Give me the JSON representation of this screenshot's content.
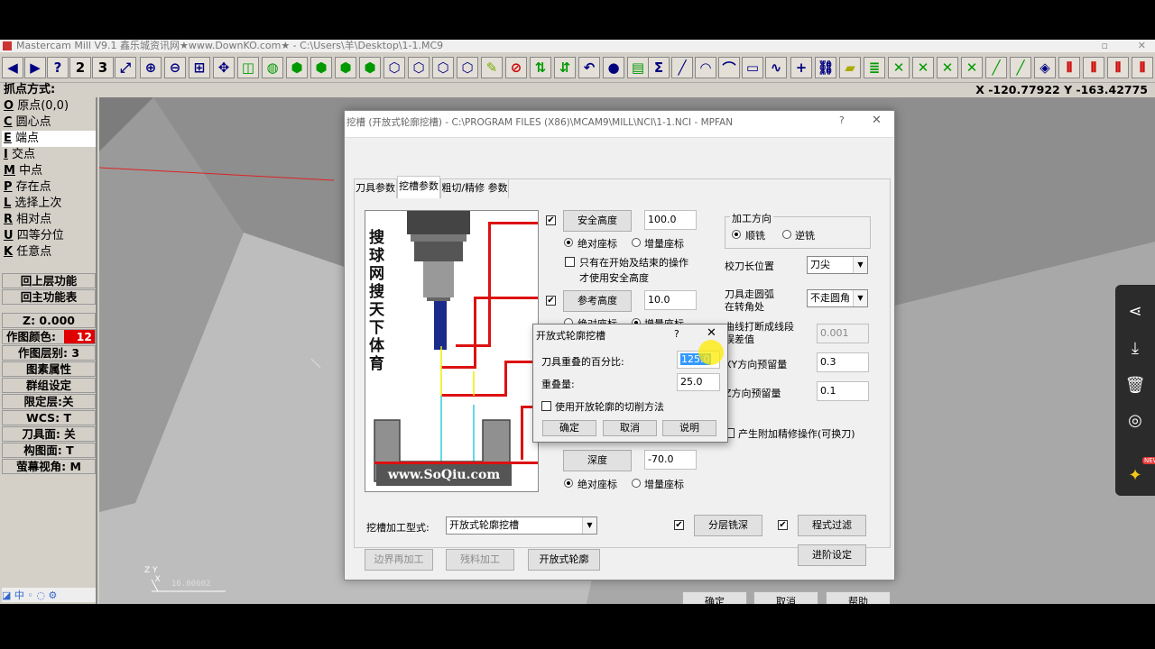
{
  "window": {
    "title": "Mastercam Mill V9.1 鑫乐城资讯网★www.DownKO.com★ - C:\\Users\\羊\\Desktop\\1-1.MC9"
  },
  "toolbar": {
    "btn1": "2",
    "btn2": "3"
  },
  "status": {
    "snap_label": "抓点方式:",
    "coords": "X -120.77922  Y -163.42775"
  },
  "menu": {
    "items": [
      {
        "key": "O",
        "label": " 原点(0,0)"
      },
      {
        "key": "C",
        "label": " 圆心点"
      },
      {
        "key": "E",
        "label": " 端点"
      },
      {
        "key": "I",
        "label": " 交点"
      },
      {
        "key": "M",
        "label": " 中点"
      },
      {
        "key": "P",
        "label": " 存在点"
      },
      {
        "key": "L",
        "label": " 选择上次"
      },
      {
        "key": "R",
        "label": " 相对点"
      },
      {
        "key": "U",
        "label": " 四等分位"
      },
      {
        "key": "K",
        "label": " 任意点"
      }
    ],
    "back_prev": "回上层功能",
    "back_main": "回主功能表",
    "z": "Z:  0.000",
    "color_label": "作图颜色:",
    "color_value": "12",
    "level": "作图层别: 3",
    "attributes": "图素属性",
    "groups": "群组设定",
    "limit_level": "限定层:关",
    "wcs": "WCS:  T",
    "tool_plane": "刀具面: 关",
    "cplane": "构图面: T",
    "gview": "萤幕视角: M"
  },
  "viewport": {
    "coord_readout": "16.00602"
  },
  "dialog": {
    "title": "挖槽 (开放式轮廓挖槽) - C:\\PROGRAM FILES (X86)\\MCAM9\\MILL\\NCI\\1-1.NCI - MPFAN",
    "help_mark": "?",
    "tabs": [
      "刀具参数",
      "挖槽参数",
      "粗切/精修 参数"
    ],
    "watermark_vertical": "搜球网 搜天下体育",
    "watermark_url": "www.SoQiu.com",
    "safe_height_btn": "安全高度",
    "safe_height_val": "100.0",
    "abs_label": "绝对座标",
    "inc_label": "增量座标",
    "only_start_end_line1": "只有在开始及结束的操作",
    "only_start_end_line2": "才使用安全高度",
    "ref_height_btn": "参考高度",
    "ref_height_val": "10.0",
    "depth_btn": "深度",
    "depth_val": "-70.0",
    "machining_dir_group": "加工方向",
    "climb": "顺铣",
    "conventional": "逆铣",
    "tip_comp_label": "校刀长位置",
    "tip_comp_val": "刀尖",
    "corner_label_1": "刀具走圆弧",
    "corner_label_2": "在转角处",
    "corner_val": "不走圆角",
    "linearize_label_1": "曲线打断成线段",
    "linearize_label_2": "误差值",
    "linearize_val": "0.001",
    "xy_stock_label": "XY方向预留量",
    "xy_stock_val": "0.3",
    "z_stock_label": "Z方向预留量",
    "z_stock_val": "0.1",
    "extra_finish": "产生附加精修操作(可换刀)",
    "pocket_type_label": "挖槽加工型式:",
    "pocket_type_val": "开放式轮廓挖槽",
    "depth_cuts": "分层铣深",
    "filter": "程式过滤",
    "advanced": "进阶设定",
    "remachining": "边界再加工",
    "rest_mill": "残料加工",
    "open_btn": "开放式轮廓",
    "ok": "确定",
    "cancel": "取消",
    "help": "帮助"
  },
  "popup": {
    "title": "开放式轮廓挖槽",
    "help_mark": "?",
    "overlap_pct_label": "刀具重叠的百分比:",
    "overlap_pct_val": "125.0",
    "overlap_label": "重叠量:",
    "overlap_val": "25.0",
    "use_open_label": "使用开放轮廓的切削方法",
    "ok": "确定",
    "cancel": "取消",
    "explain": "说明"
  },
  "share_panel": {
    "badge": "NEW"
  }
}
